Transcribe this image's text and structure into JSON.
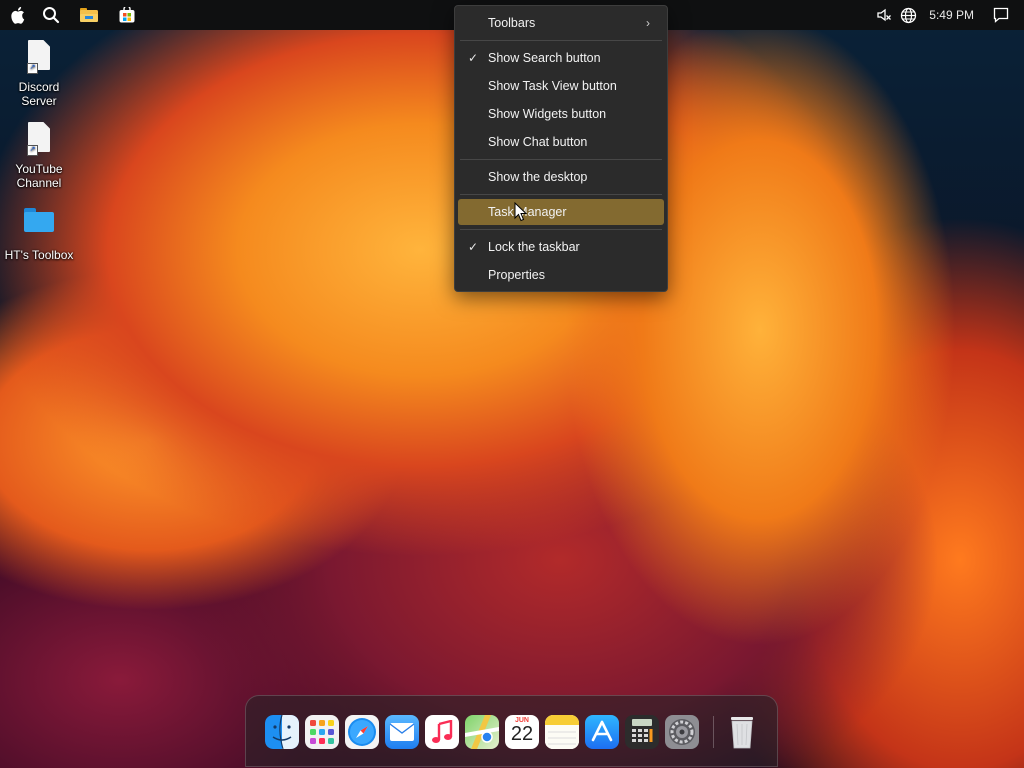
{
  "menubar": {
    "clock": "5:49 PM",
    "icons": [
      "apple-icon",
      "search-icon",
      "file-explorer-icon",
      "store-icon"
    ],
    "tray_icons": [
      "volume-muted-icon",
      "network-globe-icon",
      "notifications-icon"
    ]
  },
  "desktop": {
    "icons": [
      {
        "label": "Discord Server",
        "type": "file-shortcut"
      },
      {
        "label": "YouTube Channel",
        "type": "file-shortcut"
      },
      {
        "label": "HT's Toolbox",
        "type": "folder"
      }
    ]
  },
  "context_menu": {
    "items": [
      {
        "label": "Toolbars",
        "checked": false,
        "submenu": true
      },
      {
        "label": "Show Search button",
        "checked": true
      },
      {
        "label": "Show Task View button",
        "checked": false
      },
      {
        "label": "Show Widgets button",
        "checked": false
      },
      {
        "label": "Show Chat button",
        "checked": false
      },
      {
        "label": "Show the desktop",
        "checked": false
      },
      {
        "label": "Task Manager",
        "checked": false,
        "highlighted": true
      },
      {
        "label": "Lock the taskbar",
        "checked": true
      },
      {
        "label": "Properties",
        "checked": false
      }
    ],
    "highlight_color": "#836a30"
  },
  "dock": {
    "apps": [
      "finder",
      "launchpad",
      "safari",
      "mail",
      "music",
      "maps",
      "calendar",
      "notes",
      "app-store",
      "calculator",
      "system-preferences"
    ],
    "calendar": {
      "month": "JUN",
      "day": "22"
    },
    "trash": "trash"
  }
}
